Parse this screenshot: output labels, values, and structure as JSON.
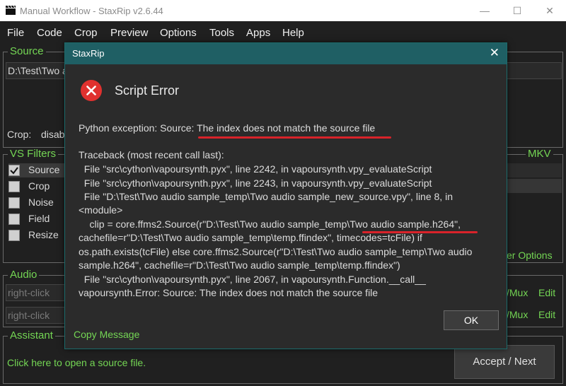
{
  "window": {
    "title": "Manual Workflow - StaxRip v2.6.44"
  },
  "menu": [
    "File",
    "Code",
    "Crop",
    "Preview",
    "Options",
    "Tools",
    "Apps",
    "Help"
  ],
  "source": {
    "label": "Source",
    "path": "D:\\Test\\Two a",
    "crop_text": "Crop:",
    "crop_value": "disab"
  },
  "filters": {
    "label": "VS Filters",
    "items": [
      {
        "name": "Source",
        "checked": true
      },
      {
        "name": "Crop",
        "checked": false
      },
      {
        "name": "Noise",
        "checked": false
      },
      {
        "name": "Field",
        "checked": false
      },
      {
        "name": "Resize",
        "checked": false
      }
    ]
  },
  "right_panel": {
    "mkv_label": "MKV",
    "options_text": "er Options"
  },
  "audio": {
    "label": "Audio",
    "placeholder1": "right-click",
    "placeholder2": "right-click",
    "mux1": "/Mux",
    "edit1": "Edit",
    "mux2": "/Mux",
    "edit2": "Edit"
  },
  "assistant": {
    "label": "Assistant",
    "text": "Click here to open a source file.",
    "accept_label": "Accept / Next"
  },
  "dialog": {
    "title": "StaxRip",
    "close": "✕",
    "heading": "Script Error",
    "exception_prefix": "Python exception: Source: ",
    "exception_highlight": "The index does not match the source file",
    "traceback": [
      "Traceback (most recent call last):",
      "  File \"src\\cython\\vapoursynth.pyx\", line 2242, in vapoursynth.vpy_evaluateScript",
      "  File \"src\\cython\\vapoursynth.pyx\", line 2243, in vapoursynth.vpy_evaluateScript",
      "  File \"D:\\Test\\Two audio sample_temp\\Two audio sample_new_source.vpy\", line 8, in",
      "<module>",
      "    clip = core.ffms2.Source(r\"D:\\Test\\Two audio sample_temp\\Two audio sample.h264\",",
      "cachefile=r\"D:\\Test\\Two audio sample_temp\\temp.ffindex\", timecodes=tcFile) if",
      "os.path.exists(tcFile) else core.ffms2.Source(r\"D:\\Test\\Two audio sample_temp\\Two audio",
      "sample.h264\", cachefile=r\"D:\\Test\\Two audio sample_temp\\temp.ffindex\")",
      "  File \"src\\cython\\vapoursynth.pyx\", line 2067, in vapoursynth.Function.__call__",
      "vapoursynth.Error: Source: The index does not match the source file"
    ],
    "ok_label": "OK",
    "copy_label": "Copy Message"
  },
  "colors": {
    "accent": "#74d654",
    "dialog_header": "#1f5f64",
    "error_red": "#e0312f",
    "underline": "#d9232a"
  }
}
